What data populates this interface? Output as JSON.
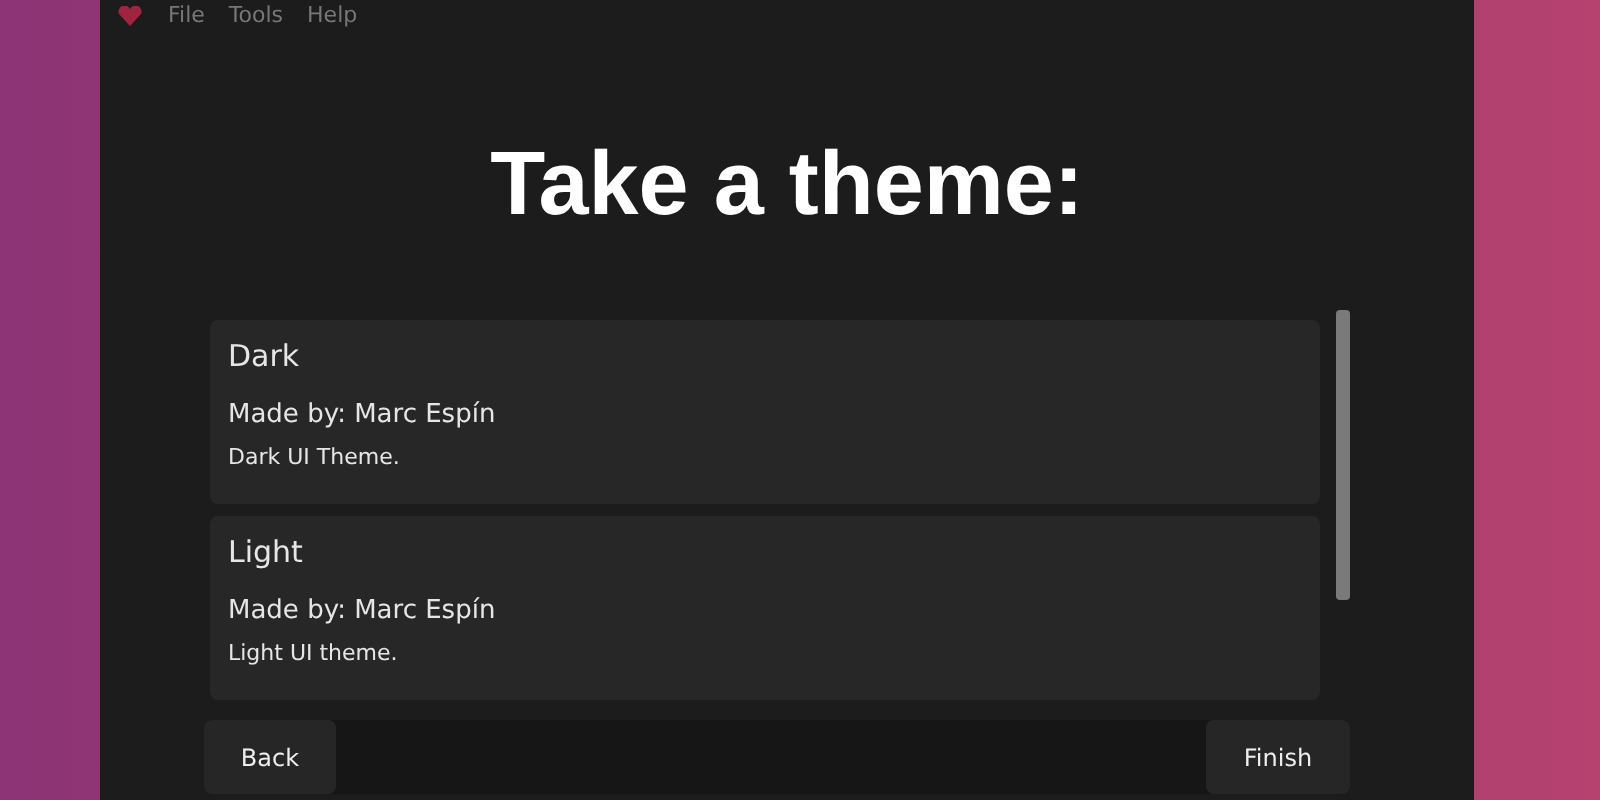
{
  "menu": [
    "File",
    "Tools",
    "Help"
  ],
  "title": "Take a theme:",
  "themes": [
    {
      "name": "Dark",
      "author": "Made by: Marc Espín",
      "description": "Dark UI Theme."
    },
    {
      "name": "Light",
      "author": "Made by: Marc Espín",
      "description": "Light UI theme."
    }
  ],
  "buttons": {
    "back": "Back",
    "finish": "Finish"
  }
}
